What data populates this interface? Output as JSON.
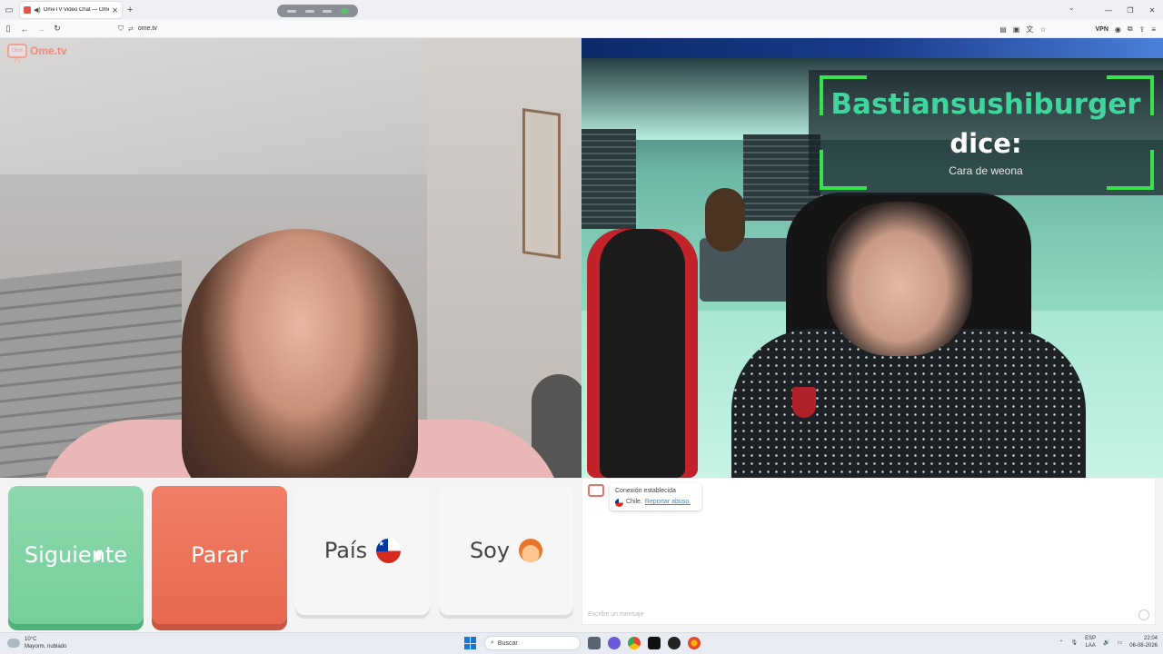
{
  "browser": {
    "tab_title": "OmeTV Video Chat — Ome",
    "tab_close": "✕",
    "new_tab": "+",
    "url": "ome.tv",
    "vpn_label": "VPN",
    "window_controls": {
      "minimize": "—",
      "restore": "❐",
      "close": "✕"
    }
  },
  "brand": {
    "logo_text": "Ome.tv",
    "logo_tv": "Ome TV"
  },
  "overlay": {
    "name": "Bastiansushiburger",
    "says": "dice:",
    "message": "Cara de weona",
    "accent": "#41d59e",
    "frame_color": "#38e24d"
  },
  "controls": {
    "next_label": "Siguiente",
    "stop_label": "Parar",
    "country_label": "País",
    "gender_label": "Soy",
    "next_color": "#7fd4a4",
    "stop_color": "#ec7359"
  },
  "chat": {
    "status": "Conexión establecida",
    "country": "Chile.",
    "report_link": "Reportar abuso.",
    "placeholder": "Escribe un mensaje"
  },
  "taskbar": {
    "temperature": "10°C",
    "weather_desc": "Mayorm. nublado",
    "search_label": "Buscar",
    "lang_1": "ESP",
    "lang_2": "LAA",
    "time": "22:04",
    "date": "06-08-2026"
  }
}
